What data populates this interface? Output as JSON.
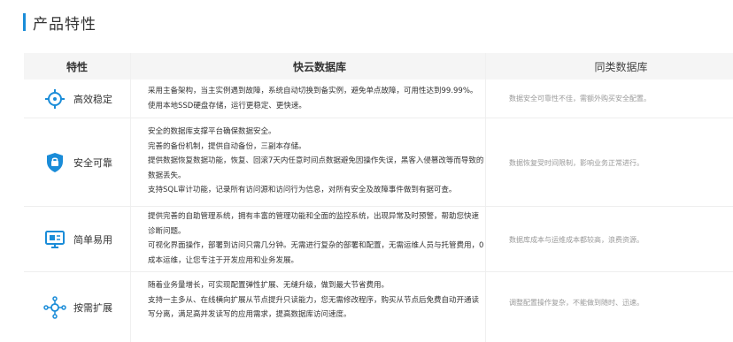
{
  "section_title": "产品特性",
  "table": {
    "headers": {
      "feature": "特性",
      "kuai": "快云数据库",
      "same": "同类数据库"
    },
    "rows": [
      {
        "feature": "高效稳定",
        "icon": "crosshair-icon",
        "kuai": [
          "采用主备架构，当主实例遇到故障，系统自动切换到备实例，避免单点故障，可用性达到99.99%。",
          "使用本地SSD硬盘存储，运行更稳定、更快速。"
        ],
        "same": "数据安全可靠性不佳，需额外购买安全配置。"
      },
      {
        "feature": "安全可靠",
        "icon": "shield-lock-icon",
        "kuai": [
          "安全的数据库支撑平台确保数据安全。",
          "完善的备份机制，提供自动备份，三副本存储。",
          "提供数据恢复数据功能，恢复、回滚7天内任意时间点数据避免因操作失误，黑客入侵篡改等而导致的",
          "数据丢失。",
          "支持SQL审计功能，记录所有访问源和访问行为信息，对所有安全及故障事件做到有据可查。"
        ],
        "same": "数据恢复受时间限制，影响业务正常进行。"
      },
      {
        "feature": "简单易用",
        "icon": "monitor-icon",
        "kuai": [
          "提供完善的自助管理系统，拥有丰富的管理功能和全面的监控系统，出现异常及时预警，帮助您快速",
          "诊断问题。",
          "可视化界面操作，部署到访问只需几分钟。无需进行复杂的部署和配置，无需运维人员与托管费用，0",
          "成本运维，让您专注于开发应用和业务发展。"
        ],
        "same": "数据库成本与运维成本都较高，浪费资源。"
      },
      {
        "feature": "按需扩展",
        "icon": "network-icon",
        "kuai": [
          "随着业务量增长，可实现配置弹性扩展、无缝升级，做到最大节省费用。",
          "支持一主多从、在线横向扩展从节点提升只读能力，您无需修改程序，购买从节点后免费自动开通读",
          "写分离，满足高并发读写的应用需求，提高数据库访问速度。"
        ],
        "same": "调整配置操作复杂，不能做到随时、迅速。"
      }
    ]
  },
  "colors": {
    "accent": "#1a8cd8",
    "header_bg": "#f5f5f5",
    "muted_text": "#999999"
  }
}
